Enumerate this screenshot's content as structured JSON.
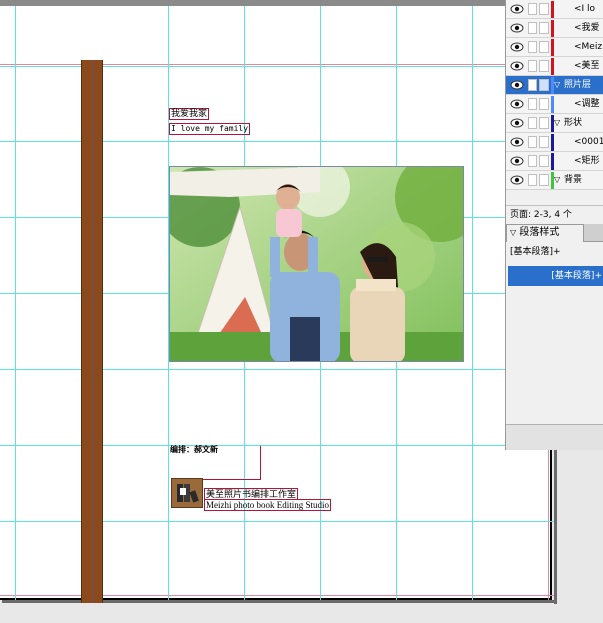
{
  "document": {
    "title_text": "我爱我家",
    "subtitle_text": "I love my family",
    "editor_text": "编排：郝文新",
    "studio_cn_text": "美至照片书编排工作室",
    "studio_en_text": "Meizhi photo book Editing Studio"
  },
  "layers_panel": {
    "layers": [
      {
        "label": "<I lo",
        "indent": true,
        "color": "#d4141c",
        "selected": false,
        "group": false
      },
      {
        "label": "<我爱",
        "indent": true,
        "color": "#d4141c",
        "selected": false,
        "group": false
      },
      {
        "label": "<Meiz",
        "indent": true,
        "color": "#d4141c",
        "selected": false,
        "group": false
      },
      {
        "label": "<美至",
        "indent": true,
        "color": "#d4141c",
        "selected": false,
        "group": false
      },
      {
        "label": "照片层",
        "indent": false,
        "color": "#4a8cff",
        "selected": true,
        "group": true
      },
      {
        "label": "<调整",
        "indent": true,
        "color": "#4a8cff",
        "selected": false,
        "group": false
      },
      {
        "label": "形状",
        "indent": false,
        "color": "#1a1a9a",
        "selected": false,
        "group": true
      },
      {
        "label": "<0001",
        "indent": true,
        "color": "#1a1a9a",
        "selected": false,
        "group": false
      },
      {
        "label": "<矩形",
        "indent": true,
        "color": "#1a1a9a",
        "selected": false,
        "group": false
      },
      {
        "label": "背景",
        "indent": false,
        "color": "#3cc83c",
        "selected": false,
        "group": true
      }
    ],
    "footer_text": "页面: 2-3, 4 个"
  },
  "paragraph_panel": {
    "tab_label": "段落样式",
    "current_style": "[基本段落]+",
    "list_item": "[基本段落]+"
  }
}
